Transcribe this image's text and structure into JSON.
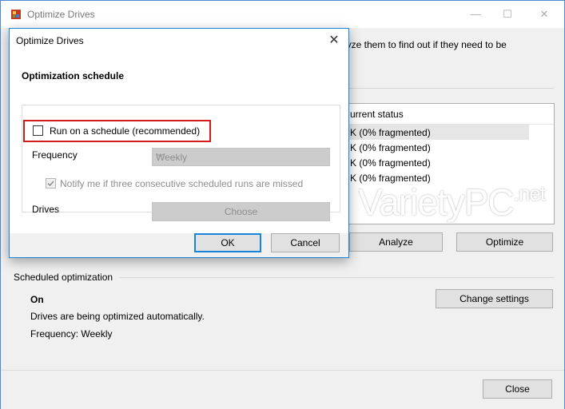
{
  "main_window": {
    "title": "Optimize Drives",
    "description_fragment": "lyze them to find out if they need to be",
    "list_header": "urrent status",
    "list_rows": [
      "K (0% fragmented)",
      "K (0% fragmented)",
      "K (0% fragmented)",
      "K (0% fragmented)"
    ],
    "analyze_label": "Analyze",
    "optimize_label": "Optimize",
    "scheduled_heading": "Scheduled optimization",
    "schedule_state": "On",
    "schedule_detail": "Drives are being optimized automatically.",
    "schedule_frequency": "Frequency: Weekly",
    "change_settings_label": "Change settings",
    "close_label": "Close"
  },
  "watermark": {
    "main": "VarietyPC",
    "suffix": ".net"
  },
  "dialog": {
    "title": "Optimize Drives",
    "close_glyph": "✕",
    "section_title": "Optimization schedule",
    "run_schedule_label": "Run on a schedule (recommended)",
    "run_schedule_checked": false,
    "frequency_label": "Frequency",
    "frequency_value": "Weekly",
    "notify_label": "Notify me if three consecutive scheduled runs are missed",
    "notify_checked": true,
    "drives_label": "Drives",
    "choose_label": "Choose",
    "ok_label": "OK",
    "cancel_label": "Cancel"
  },
  "colors": {
    "accent_blue": "#1883d7",
    "highlight_red": "#d11c1c",
    "button_face": "#e1e1e1",
    "disabled_text": "#8d8d8d"
  },
  "icons": {
    "app": "defrag-icon",
    "minimize": "minimize-icon",
    "maximize": "maximize-icon",
    "close": "close-icon",
    "dropdown": "chevron-down-icon",
    "check": "checkmark-icon"
  }
}
